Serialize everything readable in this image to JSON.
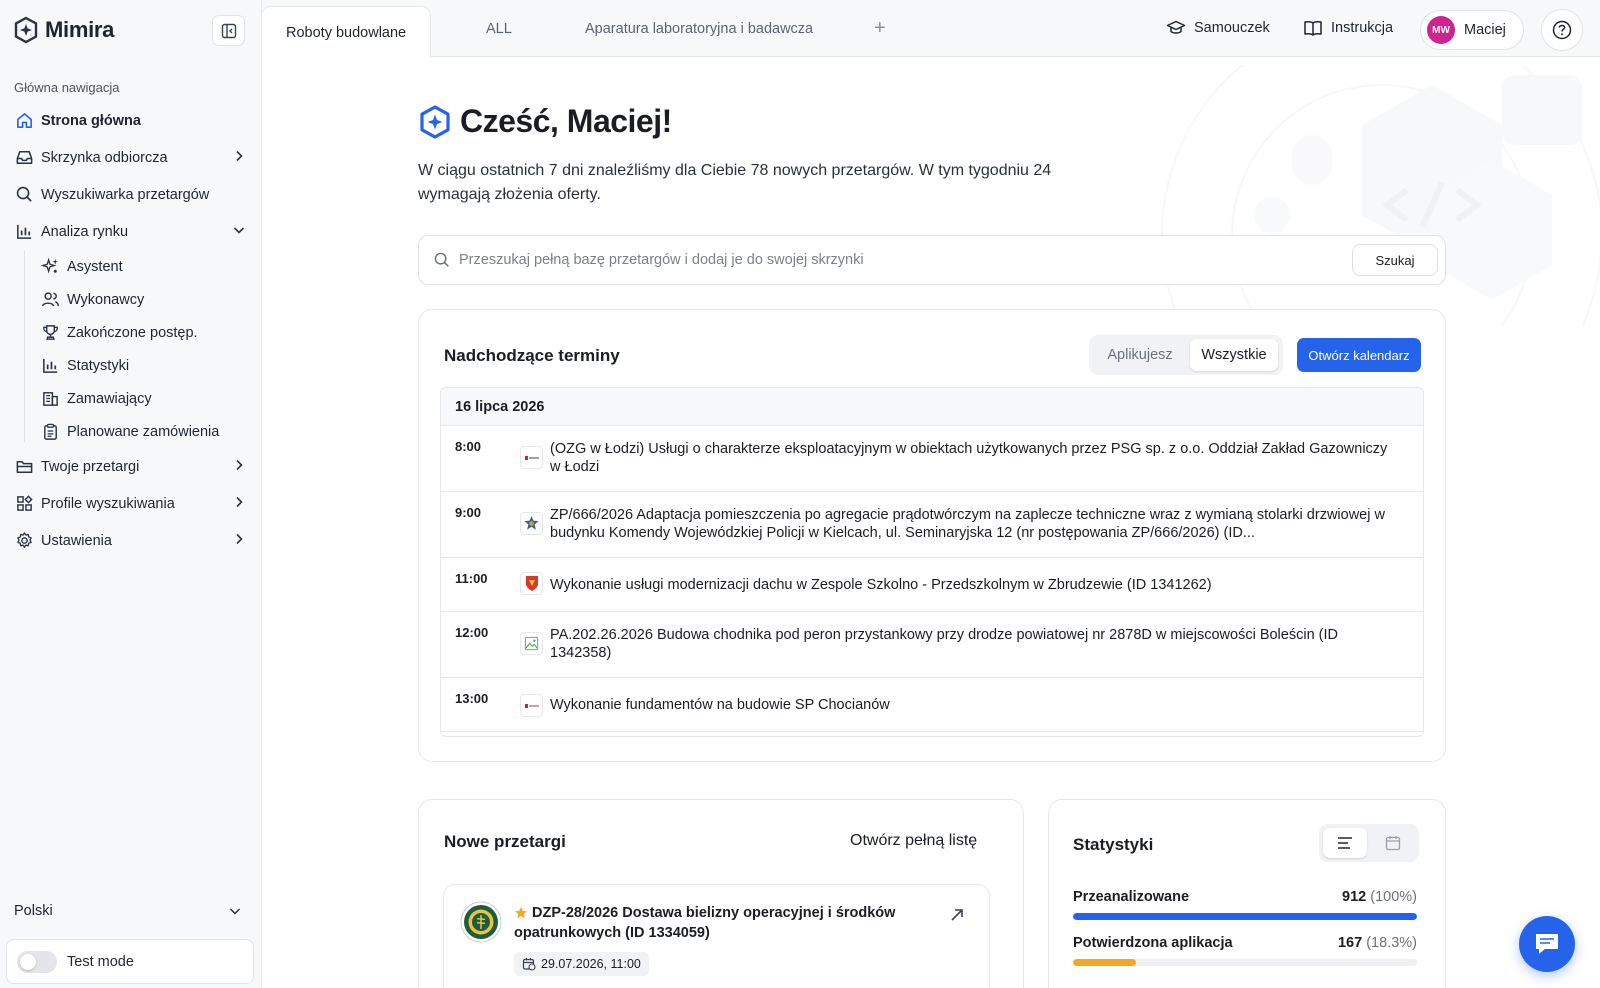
{
  "app": {
    "name": "Mimira"
  },
  "sidebar": {
    "section_label": "Główna nawigacja",
    "items": [
      {
        "label": "Strona główna"
      },
      {
        "label": "Skrzynka odbiorcza"
      },
      {
        "label": "Wyszukiwarka przetargów"
      },
      {
        "label": "Analiza rynku"
      },
      {
        "label": "Twoje przetargi"
      },
      {
        "label": "Profile wyszukiwania"
      },
      {
        "label": "Ustawienia"
      }
    ],
    "subitems": [
      {
        "label": "Asystent"
      },
      {
        "label": "Wykonawcy"
      },
      {
        "label": "Zakończone postęp."
      },
      {
        "label": "Statystyki"
      },
      {
        "label": "Zamawiający"
      },
      {
        "label": "Planowane zamówienia"
      }
    ],
    "language": "Polski",
    "test_mode_label": "Test mode"
  },
  "tabs": [
    {
      "label": "Roboty budowlane"
    },
    {
      "label": "ALL"
    },
    {
      "label": "Aparatura laboratoryjna i badawcza"
    }
  ],
  "tab_add": "+",
  "header": {
    "tutorial": "Samouczek",
    "manual": "Instrukcja",
    "user_initials": "MW",
    "user_name": "Maciej"
  },
  "main": {
    "greeting": "Cześć, Maciej!",
    "intro": "W ciągu ostatnich 7 dni znaleźliśmy dla Ciebie 78 nowych przetargów. W tym tygodniu 24 wymagają złożenia oferty.",
    "search_placeholder": "Przeszukaj pełną bazę przetargów i dodaj je do swojej skrzynki",
    "search_button": "Szukaj"
  },
  "deadlines": {
    "title": "Nadchodzące terminy",
    "filter_applying": "Aplikujesz",
    "filter_all": "Wszystkie",
    "calendar_button": "Otwórz kalendarz",
    "date": "16 lipca 2026",
    "rows": [
      {
        "time": "8:00",
        "text": "(OZG w Łodzi) Usługi o charakterze eksploatacyjnym w obiektach użytkowanych przez PSG sp. z o.o. Oddział Zakład Gazowniczy w Łodzi"
      },
      {
        "time": "9:00",
        "text": "ZP/666/2026 Adaptacja pomieszczenia po agregacie prądotwórczym na zaplecze techniczne wraz z wymianą stolarki drzwiowej w budynku Komendy Wojewódzkiej Policji w Kielcach, ul. Seminaryjska 12 (nr postępowania ZP/666/2026) (ID..."
      },
      {
        "time": "11:00",
        "text": "Wykonanie usługi modernizacji dachu w Zespole Szkolno - Przedszkolnym w Zbrudzewie (ID 1341262)"
      },
      {
        "time": "12:00",
        "text": "PA.202.26.2026 Budowa chodnika pod peron przystankowy przy drodze powiatowej nr 2878D w miejscowości Boleścin (ID 1342358)"
      },
      {
        "time": "13:00",
        "text": "Wykonanie fundamentów na budowie SP Chocianów"
      }
    ]
  },
  "new_tenders": {
    "title": "Nowe przetargi",
    "open_list": "Otwórz pełną listę",
    "item_title": "DZP-28/2026 Dostawa bielizny operacyjnej i środków opatrunkowych (ID 1334059)",
    "item_date": "29.07.2026, 11:00"
  },
  "stats": {
    "title": "Statystyki",
    "rows": [
      {
        "label": "Przeanalizowane",
        "count": "912",
        "pct": "(100%)",
        "fraction": 1.0,
        "color": "#2563eb"
      },
      {
        "label": "Potwierdzona aplikacja",
        "count": "167",
        "pct": "(18.3%)",
        "fraction": 0.183,
        "color": "#f5a623"
      }
    ]
  }
}
